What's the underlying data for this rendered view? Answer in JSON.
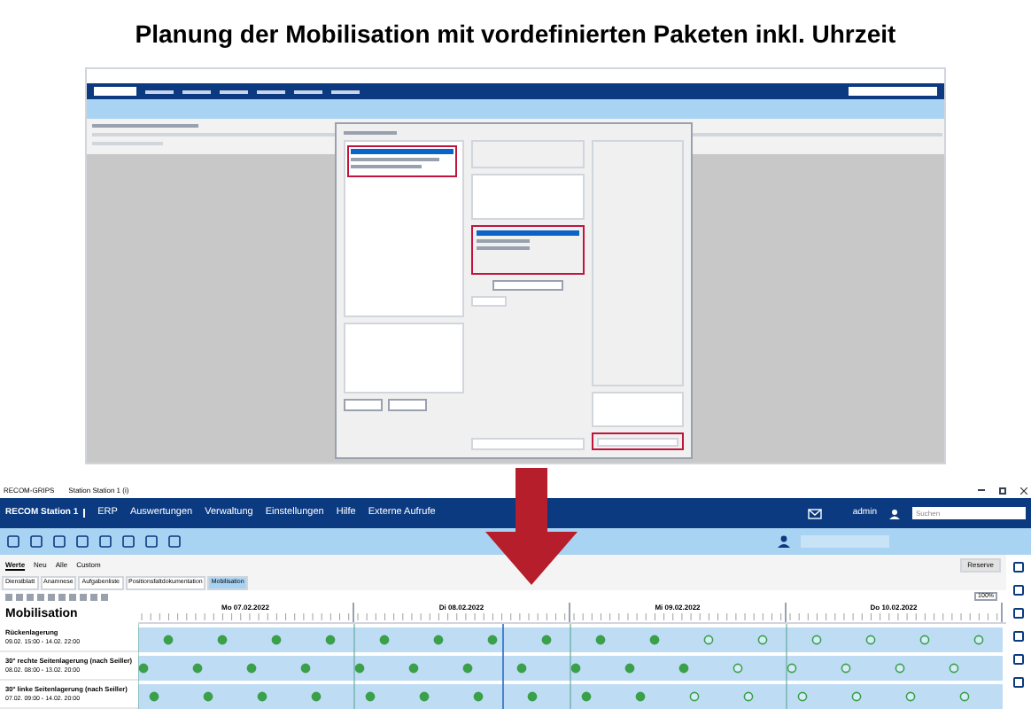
{
  "headline": "Planung der Mobilisation mit vordefinierten Paketen inkl. Uhrzeit",
  "top_screenshot": {
    "menu": [
      {
        "kind": "item"
      },
      {
        "kind": "item"
      },
      {
        "kind": "item"
      },
      {
        "kind": "item"
      },
      {
        "kind": "item"
      },
      {
        "kind": "item"
      }
    ]
  },
  "bottom_screenshot": {
    "window_title": "RECOM-GRIPS",
    "station": "Station Station 1 (i)",
    "logo": "RECOM Station 1",
    "menu": [
      "ERP",
      "Auswertungen",
      "Verwaltung",
      "Einstellungen",
      "Hilfe",
      "Externe Aufrufe"
    ],
    "user": "admin",
    "search": {
      "placeholder": "Suchen"
    },
    "tabs": [
      {
        "label": "Werte",
        "selected": true
      },
      {
        "label": "Neu",
        "selected": false
      },
      {
        "label": "Alle",
        "selected": false
      },
      {
        "label": "Custom",
        "selected": false
      }
    ],
    "reserve_button": "Reserve",
    "subtabs": [
      {
        "label": "Dienstblatt",
        "selected": false
      },
      {
        "label": "Anamnese",
        "selected": false
      },
      {
        "label": "Aufgabenliste",
        "selected": false
      },
      {
        "label": "Positionsfaltdokumentation",
        "selected": false
      },
      {
        "label": "Mobilisation",
        "selected": true
      }
    ],
    "zoom": "100%",
    "section_title": "Mobilisation",
    "days": [
      "Mo 07.02.2022",
      "Di 08.02.2022",
      "Mi 09.02.2022",
      "Do 10.02.2022"
    ],
    "rows": [
      {
        "name": "Rückenlagerung",
        "period": "09.02. 15:00 - 14.02. 22:00",
        "dots": [
          {
            "done": true
          },
          {
            "done": true
          },
          {
            "done": true
          },
          {
            "done": true
          },
          {
            "done": true
          },
          {
            "done": true
          },
          {
            "done": true
          },
          {
            "done": true
          },
          {
            "done": true
          },
          {
            "done": true
          },
          {
            "done": false
          },
          {
            "done": false
          },
          {
            "done": false
          },
          {
            "done": false
          },
          {
            "done": false
          },
          {
            "done": false
          }
        ]
      },
      {
        "name": "30° rechte Seitenlagerung (nach Seiller)",
        "period": "08.02. 08:00 - 13.02. 20:00",
        "dots": [
          {
            "done": true
          },
          {
            "done": true
          },
          {
            "done": true
          },
          {
            "done": true
          },
          {
            "done": true
          },
          {
            "done": true
          },
          {
            "done": true
          },
          {
            "done": true
          },
          {
            "done": true
          },
          {
            "done": true
          },
          {
            "done": true
          },
          {
            "done": false
          },
          {
            "done": false
          },
          {
            "done": false
          },
          {
            "done": false
          },
          {
            "done": false
          }
        ]
      },
      {
        "name": "30° linke Seitenlagerung (nach Seiller)",
        "period": "07.02. 09:00 - 14.02. 20:00",
        "dots": [
          {
            "done": true
          },
          {
            "done": true
          },
          {
            "done": true
          },
          {
            "done": true
          },
          {
            "done": true
          },
          {
            "done": true
          },
          {
            "done": true
          },
          {
            "done": true
          },
          {
            "done": true
          },
          {
            "done": true
          },
          {
            "done": false
          },
          {
            "done": false
          },
          {
            "done": false
          },
          {
            "done": false
          },
          {
            "done": false
          },
          {
            "done": false
          }
        ]
      }
    ]
  }
}
